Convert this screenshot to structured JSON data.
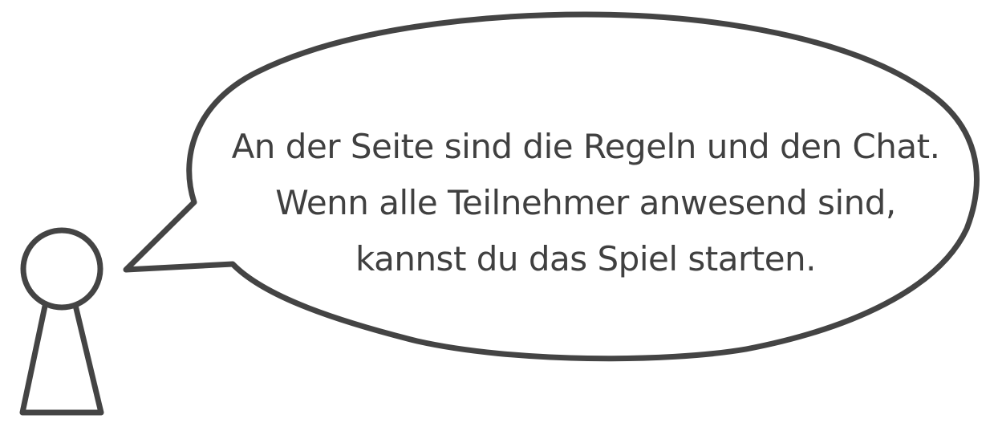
{
  "speech_bubble": {
    "lines": [
      "An der Seite sind die Regeln und den Chat.",
      "Wenn alle Teilnehmer anwesend sind,",
      "kannst du das Spiel starten."
    ]
  },
  "colors": {
    "outline": "#444444",
    "text": "#404040",
    "background": "#ffffff"
  },
  "icons": {
    "character": "pawn-figure-icon",
    "bubble": "speech-bubble-icon"
  }
}
